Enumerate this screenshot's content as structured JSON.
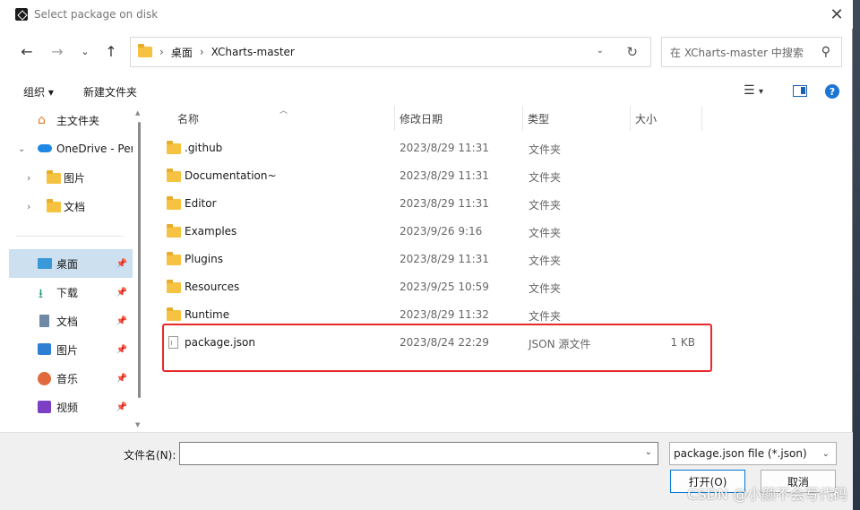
{
  "window": {
    "title": "Select package on disk"
  },
  "nav": {
    "address_crumbs": [
      "桌面",
      "XCharts-master"
    ],
    "search_placeholder": "在 XCharts-master 中搜索"
  },
  "toolbar": {
    "organize_label": "组织 ▾",
    "new_folder_label": "新建文件夹",
    "help_label": "?"
  },
  "sidebar": {
    "items": [
      {
        "label": "主文件夹"
      },
      {
        "label": "OneDrive - Per"
      },
      {
        "label": "图片"
      },
      {
        "label": "文档"
      },
      {
        "label": "桌面"
      },
      {
        "label": "下载"
      },
      {
        "label": "文档"
      },
      {
        "label": "图片"
      },
      {
        "label": "音乐"
      },
      {
        "label": "视频"
      }
    ]
  },
  "filelist": {
    "columns": [
      "名称",
      "修改日期",
      "类型",
      "大小"
    ],
    "rows": [
      {
        "name": ".github",
        "date": "2023/8/29 11:31",
        "type": "文件夹",
        "size": "",
        "icon": "folder-icon"
      },
      {
        "name": "Documentation~",
        "date": "2023/8/29 11:31",
        "type": "文件夹",
        "size": "",
        "icon": "folder-icon"
      },
      {
        "name": "Editor",
        "date": "2023/8/29 11:31",
        "type": "文件夹",
        "size": "",
        "icon": "folder-icon"
      },
      {
        "name": "Examples",
        "date": "2023/9/26 9:16",
        "type": "文件夹",
        "size": "",
        "icon": "folder-icon"
      },
      {
        "name": "Plugins",
        "date": "2023/8/29 11:31",
        "type": "文件夹",
        "size": "",
        "icon": "folder-icon"
      },
      {
        "name": "Resources",
        "date": "2023/9/25 10:59",
        "type": "文件夹",
        "size": "",
        "icon": "folder-icon"
      },
      {
        "name": "Runtime",
        "date": "2023/8/29 11:32",
        "type": "文件夹",
        "size": "",
        "icon": "folder-icon"
      },
      {
        "name": "package.json",
        "date": "2023/8/24 22:29",
        "type": "JSON 源文件",
        "size": "1 KB",
        "icon": "json-file-icon"
      }
    ]
  },
  "bottom": {
    "filename_label": "文件名(N):",
    "filename_value": "",
    "filter_value": "package.json file (*.json)",
    "open_label": "打开(O)",
    "cancel_label": "取消"
  },
  "watermark": "CSDN @小颜不会写代码",
  "colors": {
    "highlight": "#e8282b",
    "selected": "#cce0f0",
    "folder": "#f5c242",
    "accent": "#0078d4"
  }
}
